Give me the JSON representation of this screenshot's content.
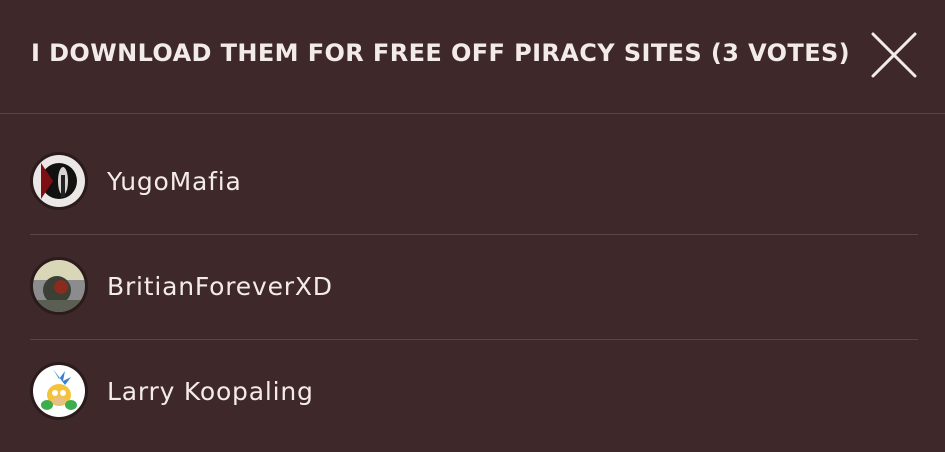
{
  "dialog": {
    "title": "I DOWNLOAD THEM FOR FREE OFF PIRACY SITES (3 VOTES)",
    "close_icon": "close-icon"
  },
  "voters": [
    {
      "name": "YugoMafia",
      "avatar_icon": "user-avatar"
    },
    {
      "name": "BritianForeverXD",
      "avatar_icon": "user-avatar"
    },
    {
      "name": "Larry Koopaling",
      "avatar_icon": "user-avatar"
    }
  ],
  "colors": {
    "background": "#3e2829",
    "divider": "#5a4446",
    "text": "#f3ebe9"
  }
}
